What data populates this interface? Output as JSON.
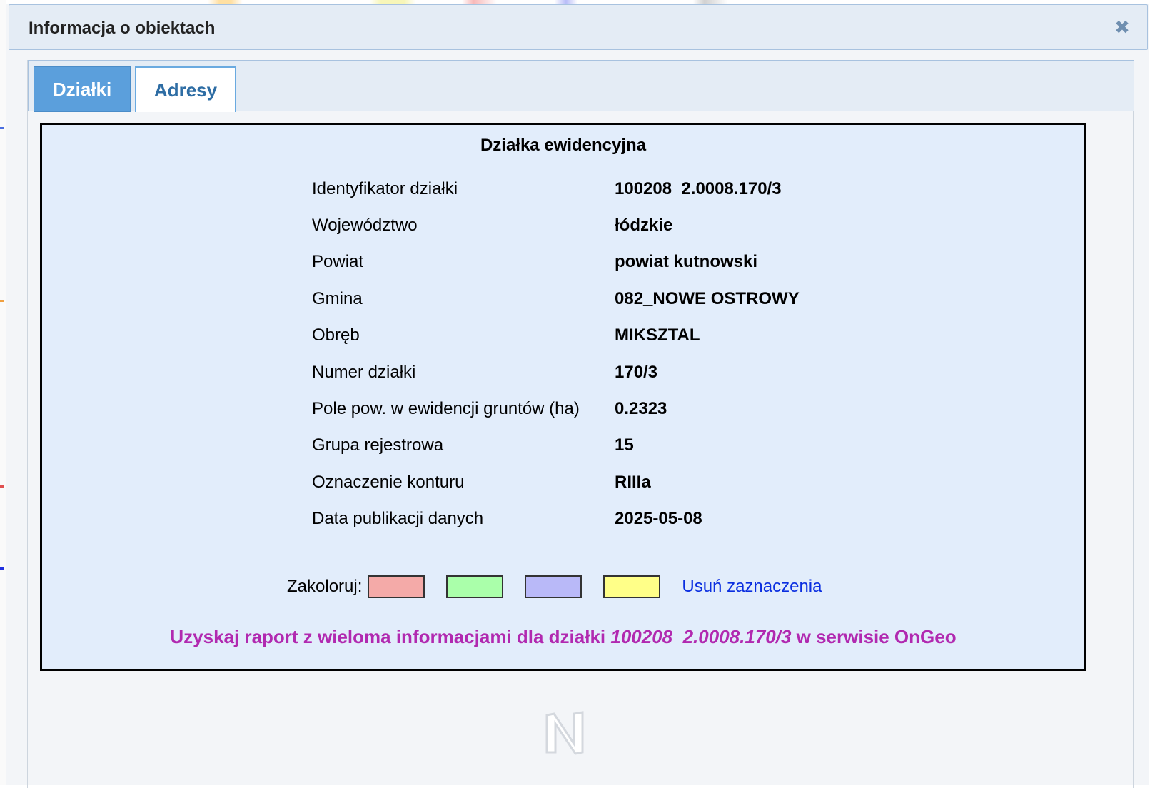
{
  "dialog": {
    "title": "Informacja o obiektach",
    "close_icon": "close-icon"
  },
  "tabs": [
    {
      "label": "Działki",
      "active": true
    },
    {
      "label": "Adresy",
      "active": false
    }
  ],
  "panel": {
    "heading": "Działka ewidencyjna",
    "rows": [
      {
        "label": "Identyfikator działki",
        "value": "100208_2.0008.170/3"
      },
      {
        "label": "Województwo",
        "value": "łódzkie"
      },
      {
        "label": "Powiat",
        "value": "powiat kutnowski"
      },
      {
        "label": "Gmina",
        "value": "082_NOWE OSTROWY"
      },
      {
        "label": "Obręb",
        "value": "MIKSZTAL"
      },
      {
        "label": "Numer działki",
        "value": "170/3"
      },
      {
        "label": "Pole pow. w ewidencji gruntów (ha)",
        "value": "0.2323"
      },
      {
        "label": "Grupa rejestrowa",
        "value": "15"
      },
      {
        "label": "Oznaczenie konturu",
        "value": "RIIIa"
      },
      {
        "label": "Data publikacji danych",
        "value": "2025-05-08"
      }
    ],
    "colorize": {
      "label": "Zakoloruj:",
      "swatches": [
        "#f4aaa8",
        "#aaffaa",
        "#b9b9f8",
        "#ffff88"
      ],
      "clear_label": "Usuń zaznaczenia"
    },
    "report": {
      "prefix": "Uzyskaj raport z wieloma informacjami dla działki ",
      "parcel_id": "100208_2.0008.170/3",
      "suffix": " w serwisie OnGeo"
    }
  },
  "colors": {
    "tab_active_bg": "#5b9fdc",
    "panel_bg": "#e2edfb",
    "link": "#0a2ee0",
    "report": "#b129b0"
  }
}
